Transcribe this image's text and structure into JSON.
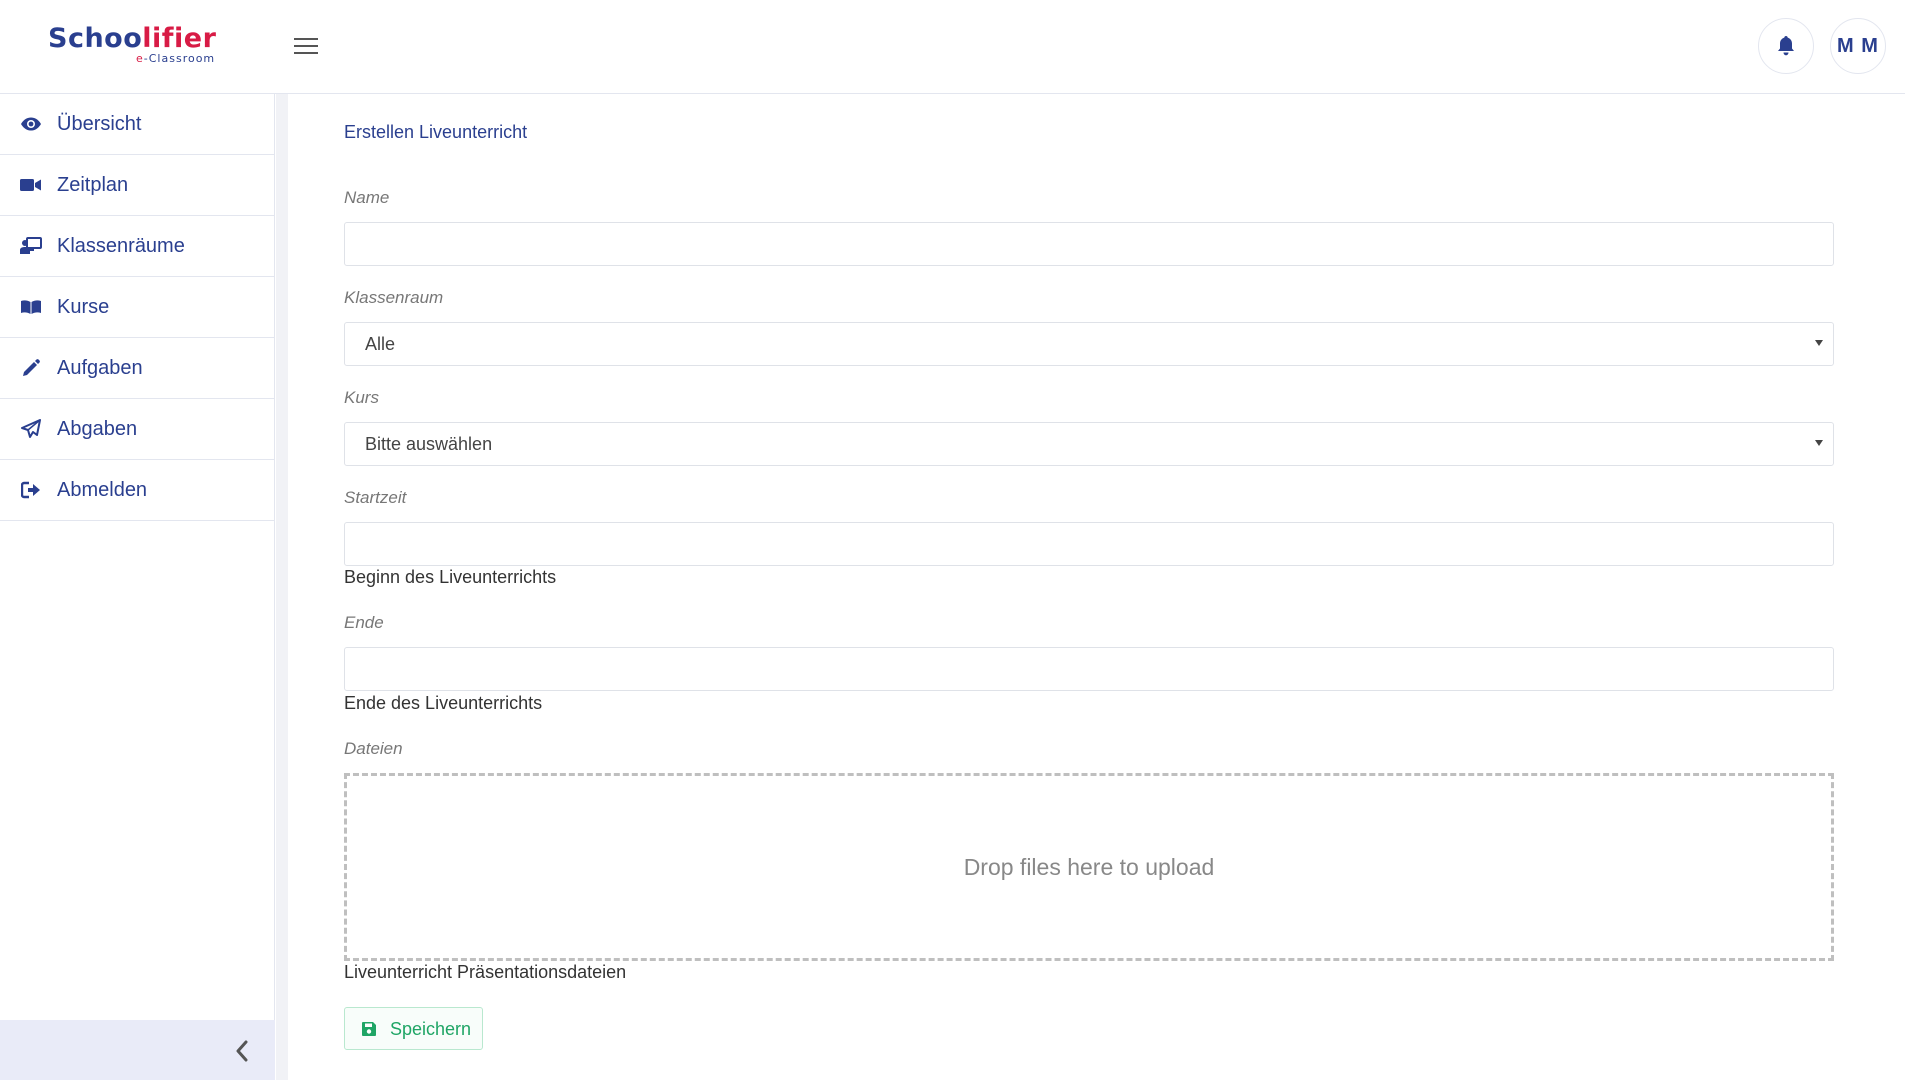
{
  "brand": {
    "name_part1": "Schoo",
    "name_part2": "lifier",
    "tagline_prefix": "e",
    "tagline_suffix": "-Classroom"
  },
  "header": {
    "avatar_initials": "M M"
  },
  "sidebar": {
    "items": [
      {
        "label": "Übersicht",
        "icon": "eye-icon"
      },
      {
        "label": "Zeitplan",
        "icon": "video-camera-icon"
      },
      {
        "label": "Klassenräume",
        "icon": "classroom-teacher-icon"
      },
      {
        "label": "Kurse",
        "icon": "book-icon"
      },
      {
        "label": "Aufgaben",
        "icon": "pencil-icon"
      },
      {
        "label": "Abgaben",
        "icon": "paper-plane-icon"
      },
      {
        "label": "Abmelden",
        "icon": "sign-out-icon"
      }
    ]
  },
  "form": {
    "title": "Erstellen Liveunterricht",
    "name_label": "Name",
    "name_value": "",
    "classroom_label": "Klassenraum",
    "classroom_value": "Alle",
    "course_label": "Kurs",
    "course_value": "Bitte auswählen",
    "start_label": "Startzeit",
    "start_value": "",
    "start_help": "Beginn des Liveunterrichts",
    "end_label": "Ende",
    "end_value": "",
    "end_help": "Ende des Liveunterrichts",
    "files_label": "Dateien",
    "dropzone_text": "Drop files here to upload",
    "files_help": "Liveunterricht Präsentationsdateien",
    "save_label": "Speichern"
  },
  "colors": {
    "brand_blue": "#2a3f8f",
    "brand_red": "#d81b45",
    "save_green": "#1fa565"
  }
}
